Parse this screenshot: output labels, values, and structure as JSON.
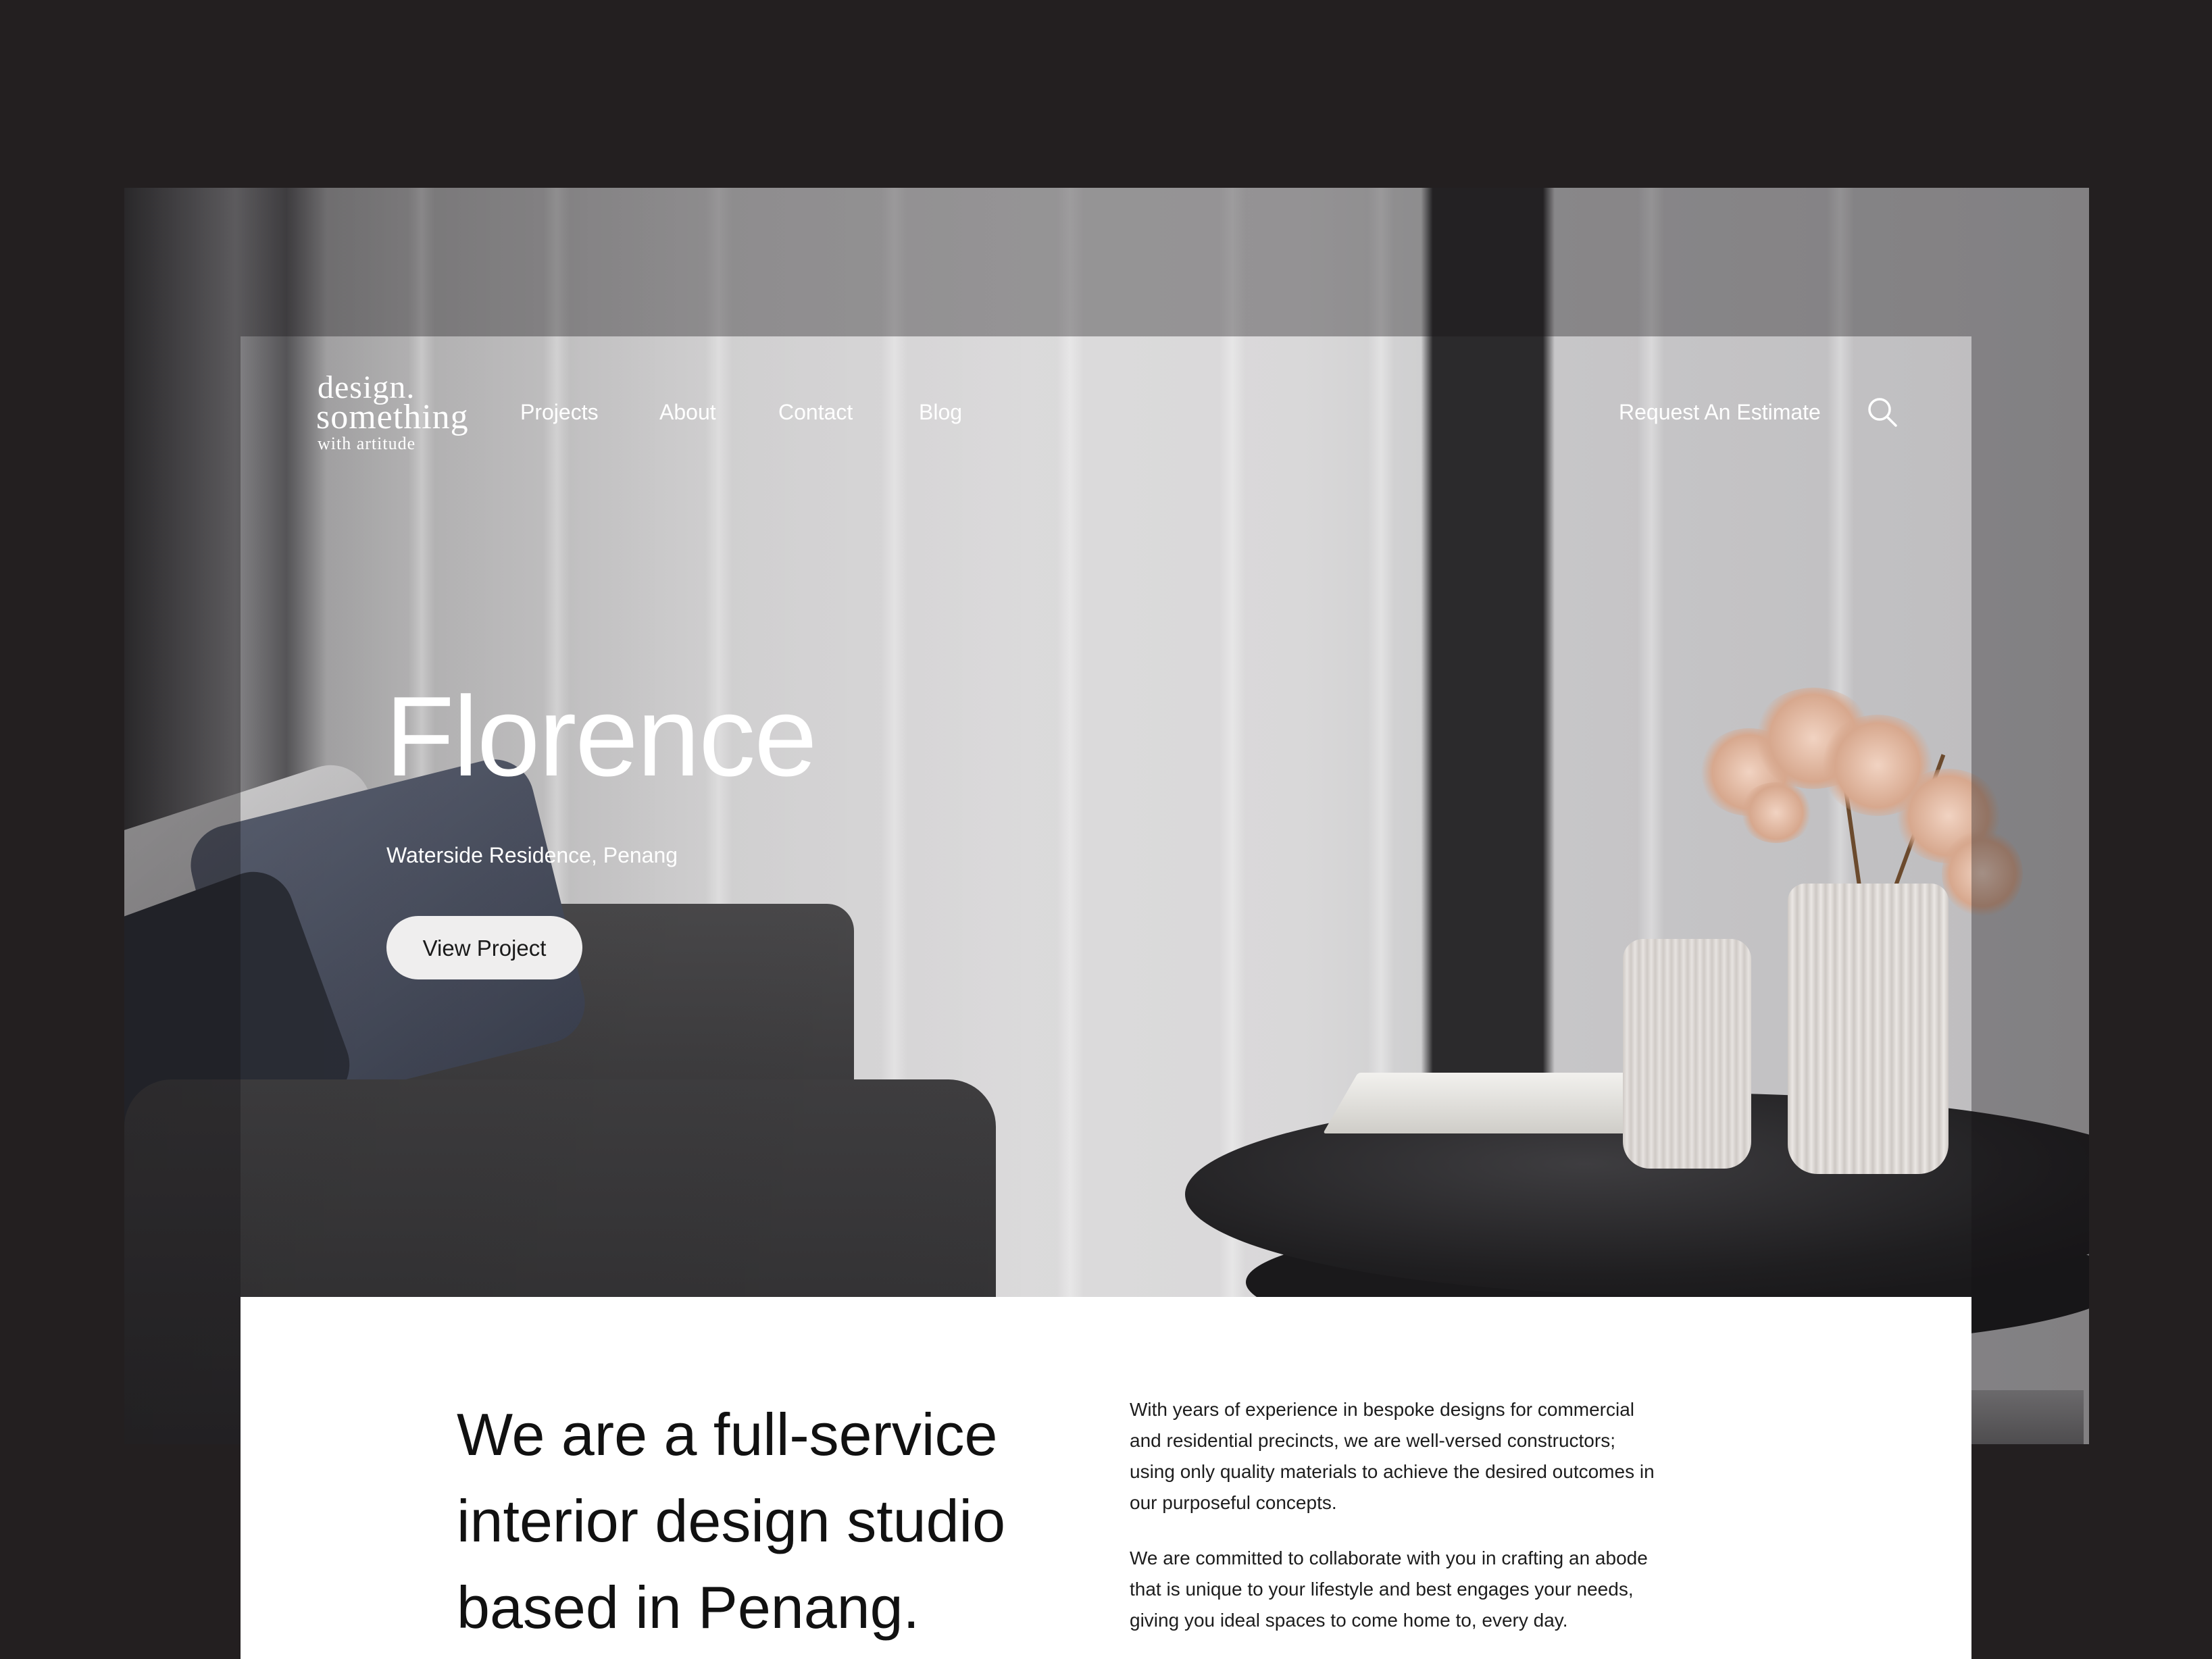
{
  "logo": {
    "line1": "design.",
    "line2": "something",
    "line3": "with artitude"
  },
  "nav": {
    "items": [
      {
        "label": "Projects"
      },
      {
        "label": "About"
      },
      {
        "label": "Contact"
      },
      {
        "label": "Blog"
      }
    ],
    "cta": "Request An Estimate",
    "search_icon": "search-icon"
  },
  "hero": {
    "title": "Florence",
    "subtitle": "Waterside Residence, Penang",
    "button": "View Project"
  },
  "about": {
    "headline": "We are a full-service interior design studio based in Penang.",
    "paragraph1": "With years of experience in bespoke designs for commercial and residential precincts, we are well-versed constructors; using only quality materials to achieve the desired outcomes in our purposeful concepts.",
    "paragraph2": "We are committed to collaborate with you in crafting an abode that is unique to your lifestyle and best engages your needs, giving you ideal spaces to come home to, every day."
  },
  "colors": {
    "page_background": "#231f20",
    "content_background": "#ffffff",
    "button_background": "#efeeee",
    "text_light": "#ffffff",
    "text_dark": "#111111"
  }
}
